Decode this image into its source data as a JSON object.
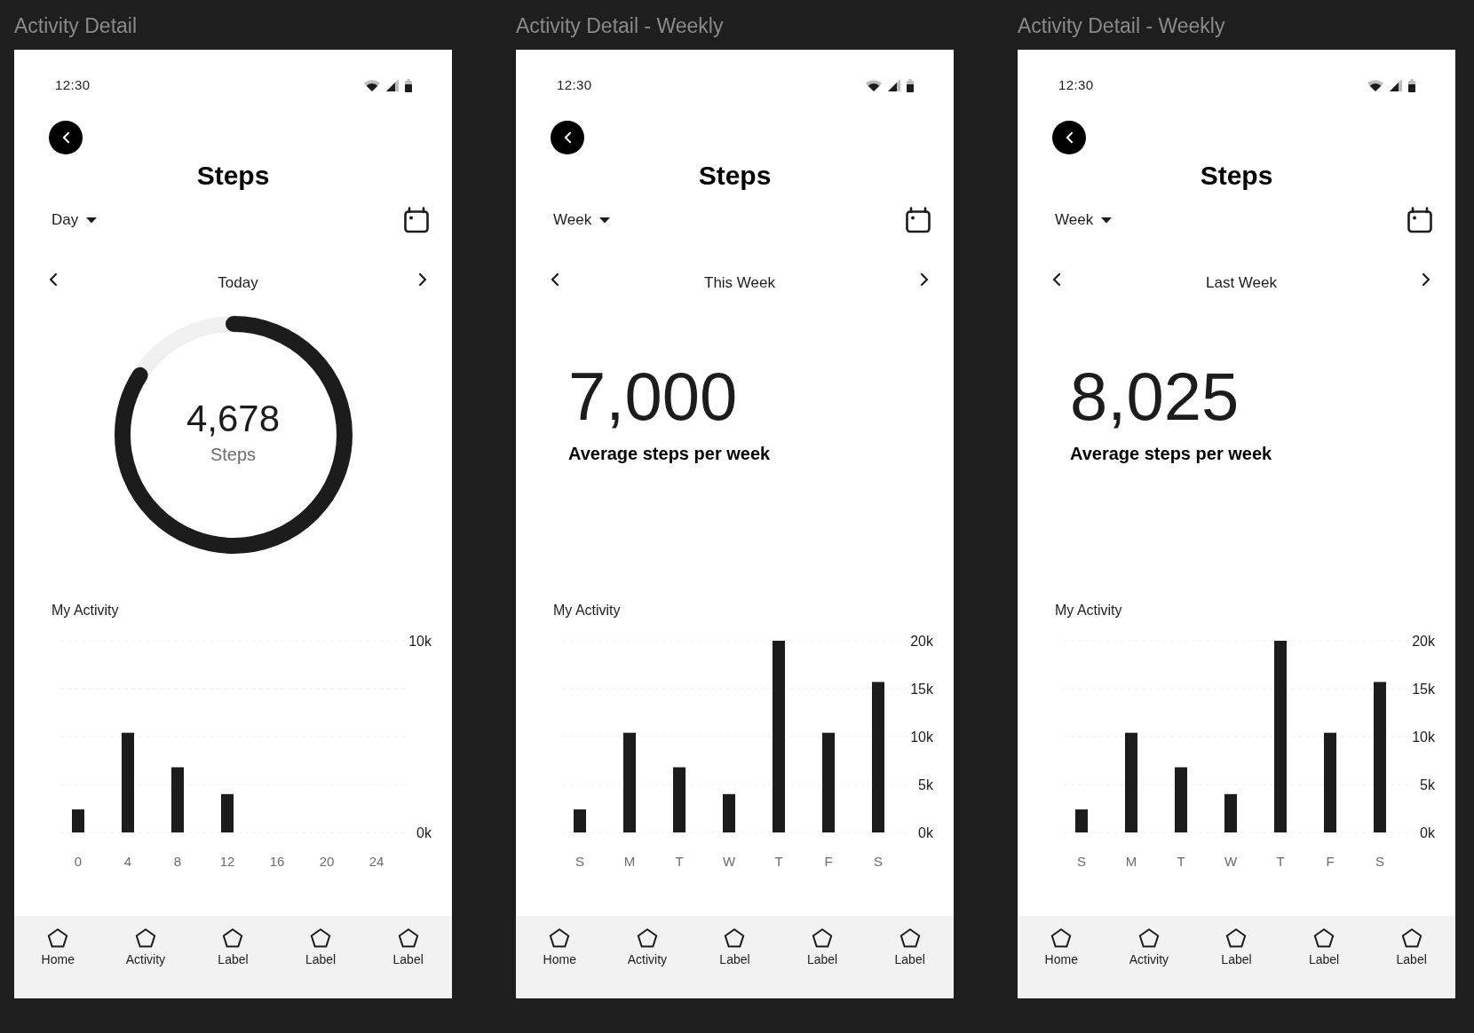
{
  "screens": [
    {
      "title": "Activity Detail",
      "status_bar": {
        "time": "12:30"
      },
      "header": {
        "title": "Steps"
      },
      "period_selector": {
        "value": "Day"
      },
      "date_nav": {
        "label": "Today"
      },
      "summary": {
        "kind": "ring",
        "value": "4,678",
        "unit": "Steps",
        "level": 0.84
      },
      "activity": {
        "title": "My Activity",
        "chart_data": {
          "type": "bar",
          "categories": [
            "0",
            "4",
            "8",
            "12",
            "16",
            "20",
            "24"
          ],
          "values": [
            1200,
            5200,
            3400,
            2000,
            null,
            null,
            null
          ],
          "color": "#1c1c1c",
          "ylim": [
            0,
            10000
          ],
          "yticks": [
            {
              "value": 0,
              "label": "0k"
            },
            {
              "value": 10000,
              "label": "10k"
            }
          ],
          "grid": true
        }
      },
      "bottom_nav": [
        {
          "label": "Home"
        },
        {
          "label": "Activity"
        },
        {
          "label": "Label"
        },
        {
          "label": "Label"
        },
        {
          "label": "Label"
        }
      ]
    },
    {
      "title": "Activity Detail - Weekly",
      "status_bar": {
        "time": "12:30"
      },
      "header": {
        "title": "Steps"
      },
      "period_selector": {
        "value": "Week"
      },
      "date_nav": {
        "label": "This Week"
      },
      "summary": {
        "kind": "figure",
        "value": "7,000",
        "caption": "Average steps per week"
      },
      "activity": {
        "title": "My Activity",
        "chart_data": {
          "type": "bar",
          "categories": [
            "S",
            "M",
            "T",
            "W",
            "T",
            "F",
            "S"
          ],
          "values": [
            2400,
            10400,
            6800,
            4000,
            20000,
            10400,
            15700
          ],
          "color": "#1c1c1c",
          "ylim": [
            0,
            20000
          ],
          "yticks": [
            {
              "value": 0,
              "label": "0k"
            },
            {
              "value": 5000,
              "label": "5k"
            },
            {
              "value": 10000,
              "label": "10k"
            },
            {
              "value": 15000,
              "label": "15k"
            },
            {
              "value": 20000,
              "label": "20k"
            }
          ],
          "grid": true
        }
      },
      "bottom_nav": [
        {
          "label": "Home"
        },
        {
          "label": "Activity"
        },
        {
          "label": "Label"
        },
        {
          "label": "Label"
        },
        {
          "label": "Label"
        }
      ]
    },
    {
      "title": "Activity Detail - Weekly",
      "status_bar": {
        "time": "12:30"
      },
      "header": {
        "title": "Steps"
      },
      "period_selector": {
        "value": "Week"
      },
      "date_nav": {
        "label": "Last Week"
      },
      "summary": {
        "kind": "figure",
        "value": "8,025",
        "caption": "Average steps per week"
      },
      "activity": {
        "title": "My Activity",
        "chart_data": {
          "type": "bar",
          "categories": [
            "S",
            "M",
            "T",
            "W",
            "T",
            "F",
            "S"
          ],
          "values": [
            2400,
            10400,
            6800,
            4000,
            20000,
            10400,
            15700
          ],
          "color": "#1c1c1c",
          "ylim": [
            0,
            20000
          ],
          "yticks": [
            {
              "value": 0,
              "label": "0k"
            },
            {
              "value": 5000,
              "label": "5k"
            },
            {
              "value": 10000,
              "label": "10k"
            },
            {
              "value": 15000,
              "label": "15k"
            },
            {
              "value": 20000,
              "label": "20k"
            }
          ],
          "grid": true
        }
      },
      "bottom_nav": [
        {
          "label": "Home"
        },
        {
          "label": "Activity"
        },
        {
          "label": "Label"
        },
        {
          "label": "Label"
        },
        {
          "label": "Label"
        }
      ]
    }
  ]
}
